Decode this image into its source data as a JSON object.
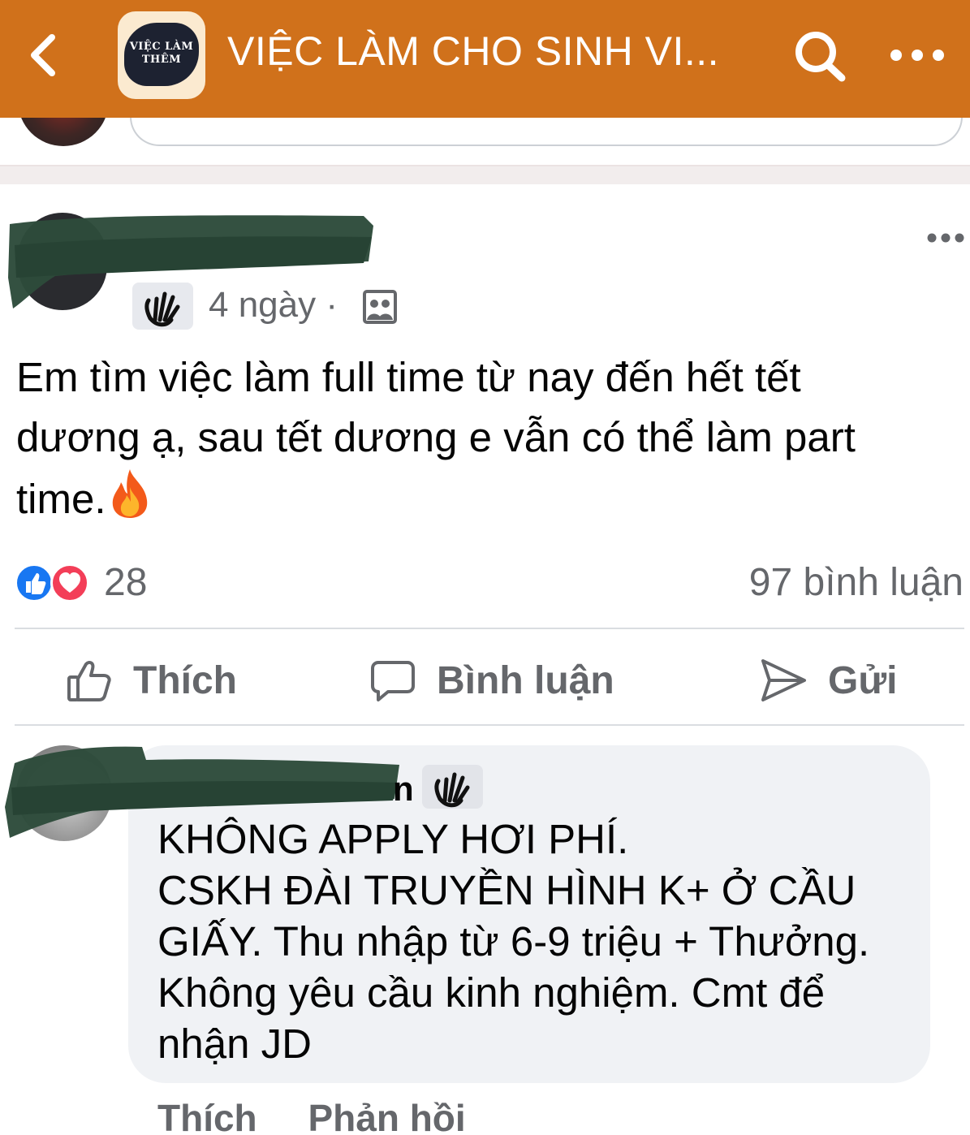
{
  "header": {
    "back_icon": "chevron-left-icon",
    "group_logo_text_line1": "VIỆC LÀM",
    "group_logo_text_line2": "THÊM",
    "title": "VIỆC LÀM CHO SINH VI...",
    "search_icon": "search-icon",
    "more_icon": "more-horizontal-icon",
    "color": "#d0711b"
  },
  "post": {
    "time": "4 ngày",
    "separator": "·",
    "audience_icon": "group-members-icon",
    "badge_icon": "waving-hand-icon",
    "text_line1": "Em tìm việc làm full time từ nay đến hết tết",
    "text_line2": "dương ạ, sau tết dương e vẫn có thể làm part",
    "text_line3": "time.",
    "emoji": "fire-icon",
    "reaction_icons": [
      "like-icon",
      "love-icon"
    ],
    "reaction_count": "28",
    "comment_count": "97 bình luận",
    "actions": {
      "like": "Thích",
      "comment": "Bình luận",
      "send": "Gửi"
    }
  },
  "comment": {
    "author_tail": "n",
    "badge_icon": "waving-hand-icon",
    "lines": [
      "KHÔNG APPLY HƠI PHÍ.",
      "CSKH ĐÀI TRUYỀN HÌNH K+ Ở CẦU",
      "GIẤY. Thu nhập từ 6-9 triệu + Thưởng.",
      "Không yêu cầu kinh nghiệm. Cmt để",
      "nhận JD"
    ],
    "actions": {
      "like": "Thích",
      "reply": "Phản hồi"
    }
  }
}
